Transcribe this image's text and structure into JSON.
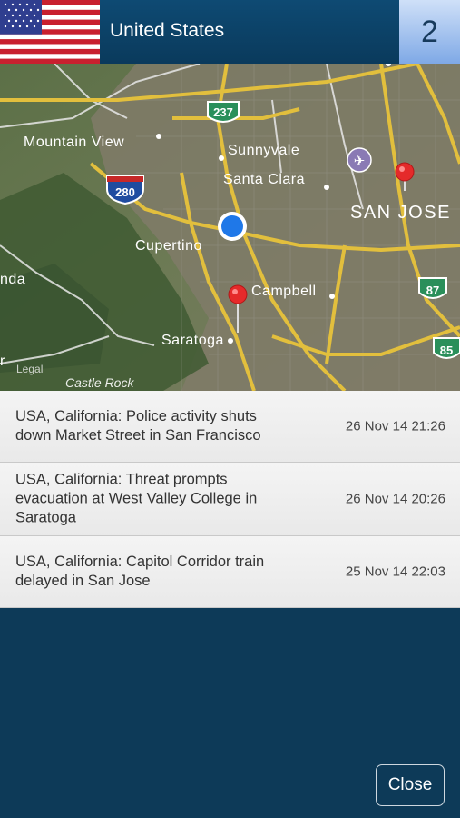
{
  "header": {
    "country": "United States",
    "count": "2",
    "flag_icon": "us-flag-icon"
  },
  "map": {
    "labels": {
      "mountain_view": "Mountain View",
      "sunnyvale": "Sunnyvale",
      "santa_clara": "Santa Clara",
      "san_jose": "San Jose",
      "cupertino": "Cupertino",
      "campbell": "Campbell",
      "saratoga": "Saratoga",
      "castle_rock": "Castle Rock",
      "nda": "nda",
      "legal": "Legal",
      "r": "r"
    },
    "shields": {
      "i280": "280",
      "h237": "237",
      "h87": "87",
      "h85": "85"
    }
  },
  "incidents": [
    {
      "title": "USA, California: Police activity shuts down Market Street in San Francisco",
      "time": "26 Nov 14 21:26"
    },
    {
      "title": "USA, California: Threat prompts evacuation at West Valley College in Saratoga",
      "time": "26 Nov 14 20:26"
    },
    {
      "title": "USA, California: Capitol Corridor train delayed in San Jose",
      "time": "25 Nov 14 22:03"
    }
  ],
  "footer": {
    "close_label": "Close"
  }
}
